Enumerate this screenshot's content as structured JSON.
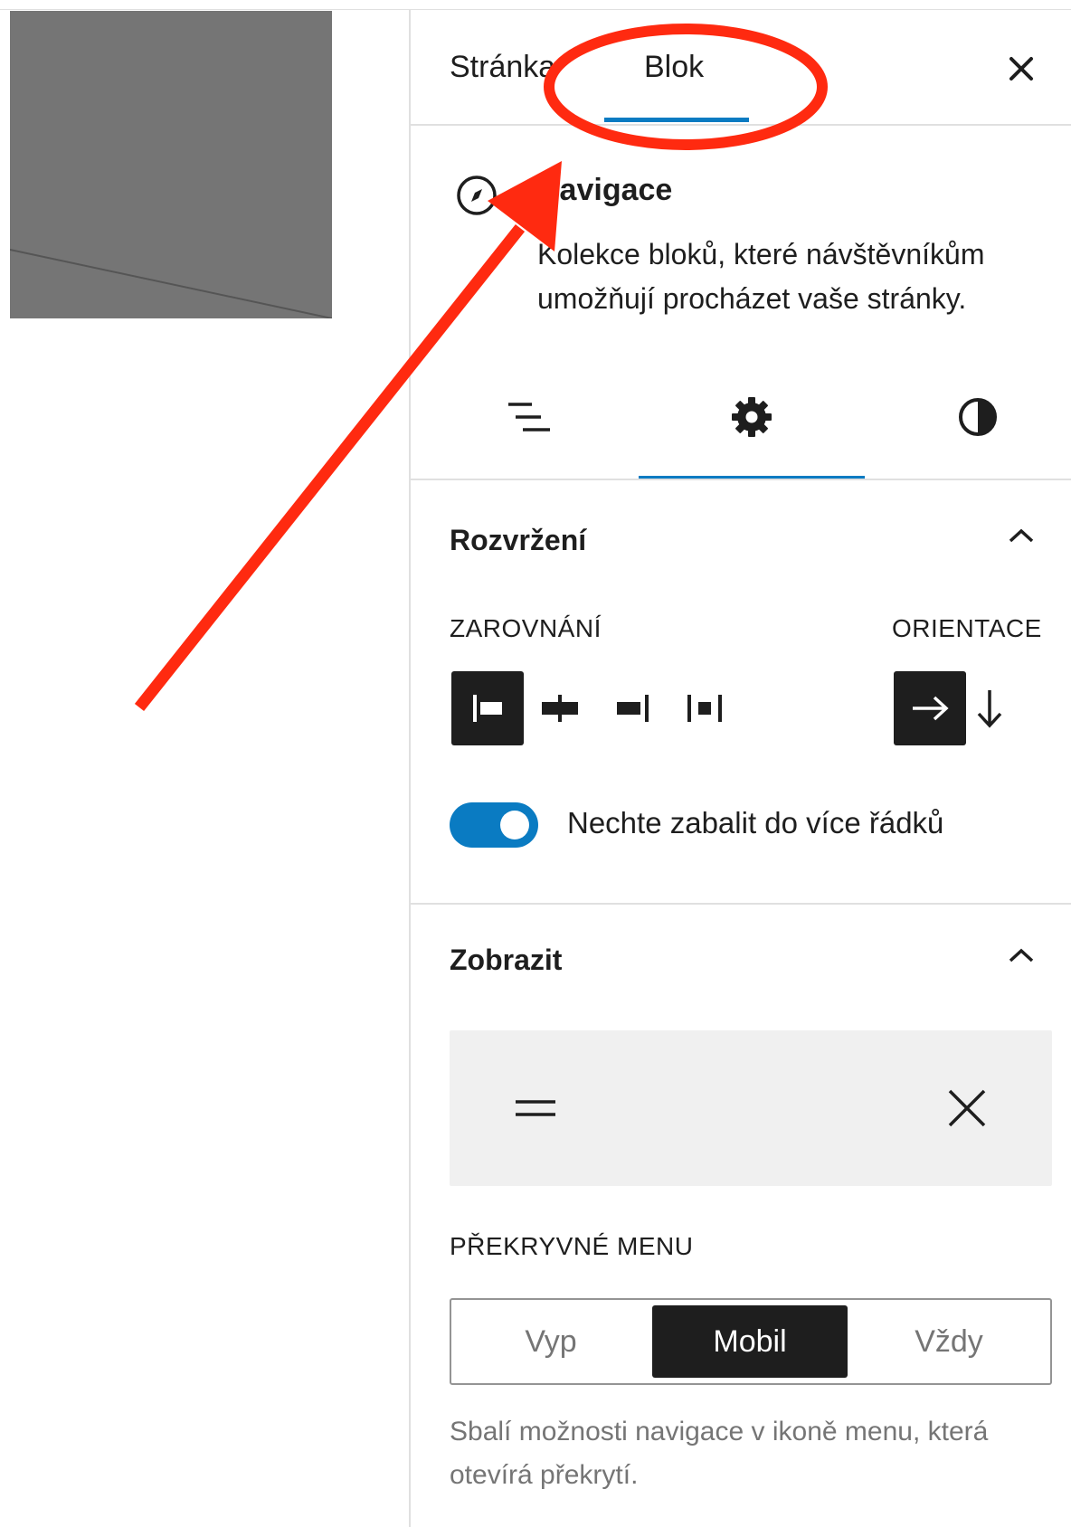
{
  "tabs": {
    "page": "Stránka",
    "block": "Blok"
  },
  "block": {
    "title": "Navigace",
    "description": "Kolekce bloků, které návštěvníkům umožňují procházet vaše stránky."
  },
  "layout": {
    "title": "Rozvržení",
    "justification_label": "ZAROVNÁNÍ",
    "orientation_label": "ORIENTACE",
    "wrap_label": "Nechte zabalit do více řádků",
    "wrap_enabled": true
  },
  "display": {
    "title": "Zobrazit",
    "overlay_label": "PŘEKRYVNÉ MENU",
    "options": [
      "Vyp",
      "Mobil",
      "Vždy"
    ],
    "selected": "Mobil",
    "help": "Sbalí možnosti navigace v ikoně menu, která otevírá překrytí."
  },
  "colors": {
    "accent": "#0a7bc2",
    "annotation": "#ff2a10",
    "dark": "#1e1e1e"
  }
}
